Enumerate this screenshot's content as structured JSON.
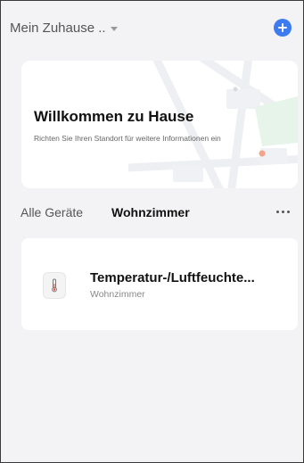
{
  "header": {
    "home_name": "Mein Zuhause ..",
    "add_icon": "plus-circle-icon",
    "accent_color": "#3d7bf0"
  },
  "welcome": {
    "title": "Willkommen zu Hause",
    "subtitle": "Richten Sie Ihren Standort für weitere Informationen ein",
    "background": "map-illustration"
  },
  "room_tabs": {
    "all_devices": "Alle Geräte",
    "active_room": "Wohnzimmer",
    "more_icon": "more-horizontal-icon"
  },
  "devices": [
    {
      "name": "Temperatur-/Luftfeuchte...",
      "room": "Wohnzimmer",
      "icon": "thermometer-icon"
    }
  ]
}
